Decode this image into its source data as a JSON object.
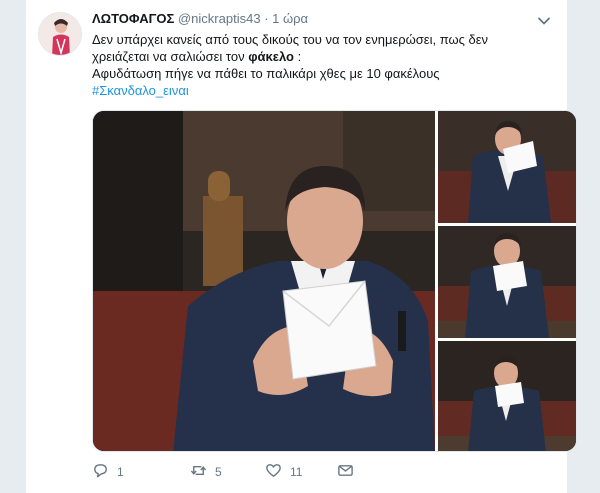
{
  "tweet": {
    "display_name": "ΛΩΤΟΦΑΓΟΣ",
    "handle": "@nickraptis43",
    "separator": "·",
    "time": "1 ώρα",
    "text_line1": "Δεν υπάρχει κανείς από τους δικούς του να τον ενημερώσει, πως δεν",
    "text_line2_prefix": "χρειάζεται να σαλιώσει τον ",
    "text_line2_bold": "φάκελο",
    "text_line2_suffix": " :",
    "text_line3": "Αφυδάτωση πήγε να πάθει το παλικάρι χθες με 10 φακέλους",
    "hashtag": "#Σκανδαλο_ειναι"
  },
  "actions": {
    "reply_count": "1",
    "retweet_count": "5",
    "like_count": "11"
  },
  "icons": {
    "reply": "reply-icon",
    "retweet": "retweet-icon",
    "like": "heart-icon",
    "dm": "direct-message-icon",
    "caret": "chevron-down-icon"
  },
  "colors": {
    "link": "#1b95e0",
    "secondary_text": "#657786",
    "background": "#e6ecf0"
  }
}
